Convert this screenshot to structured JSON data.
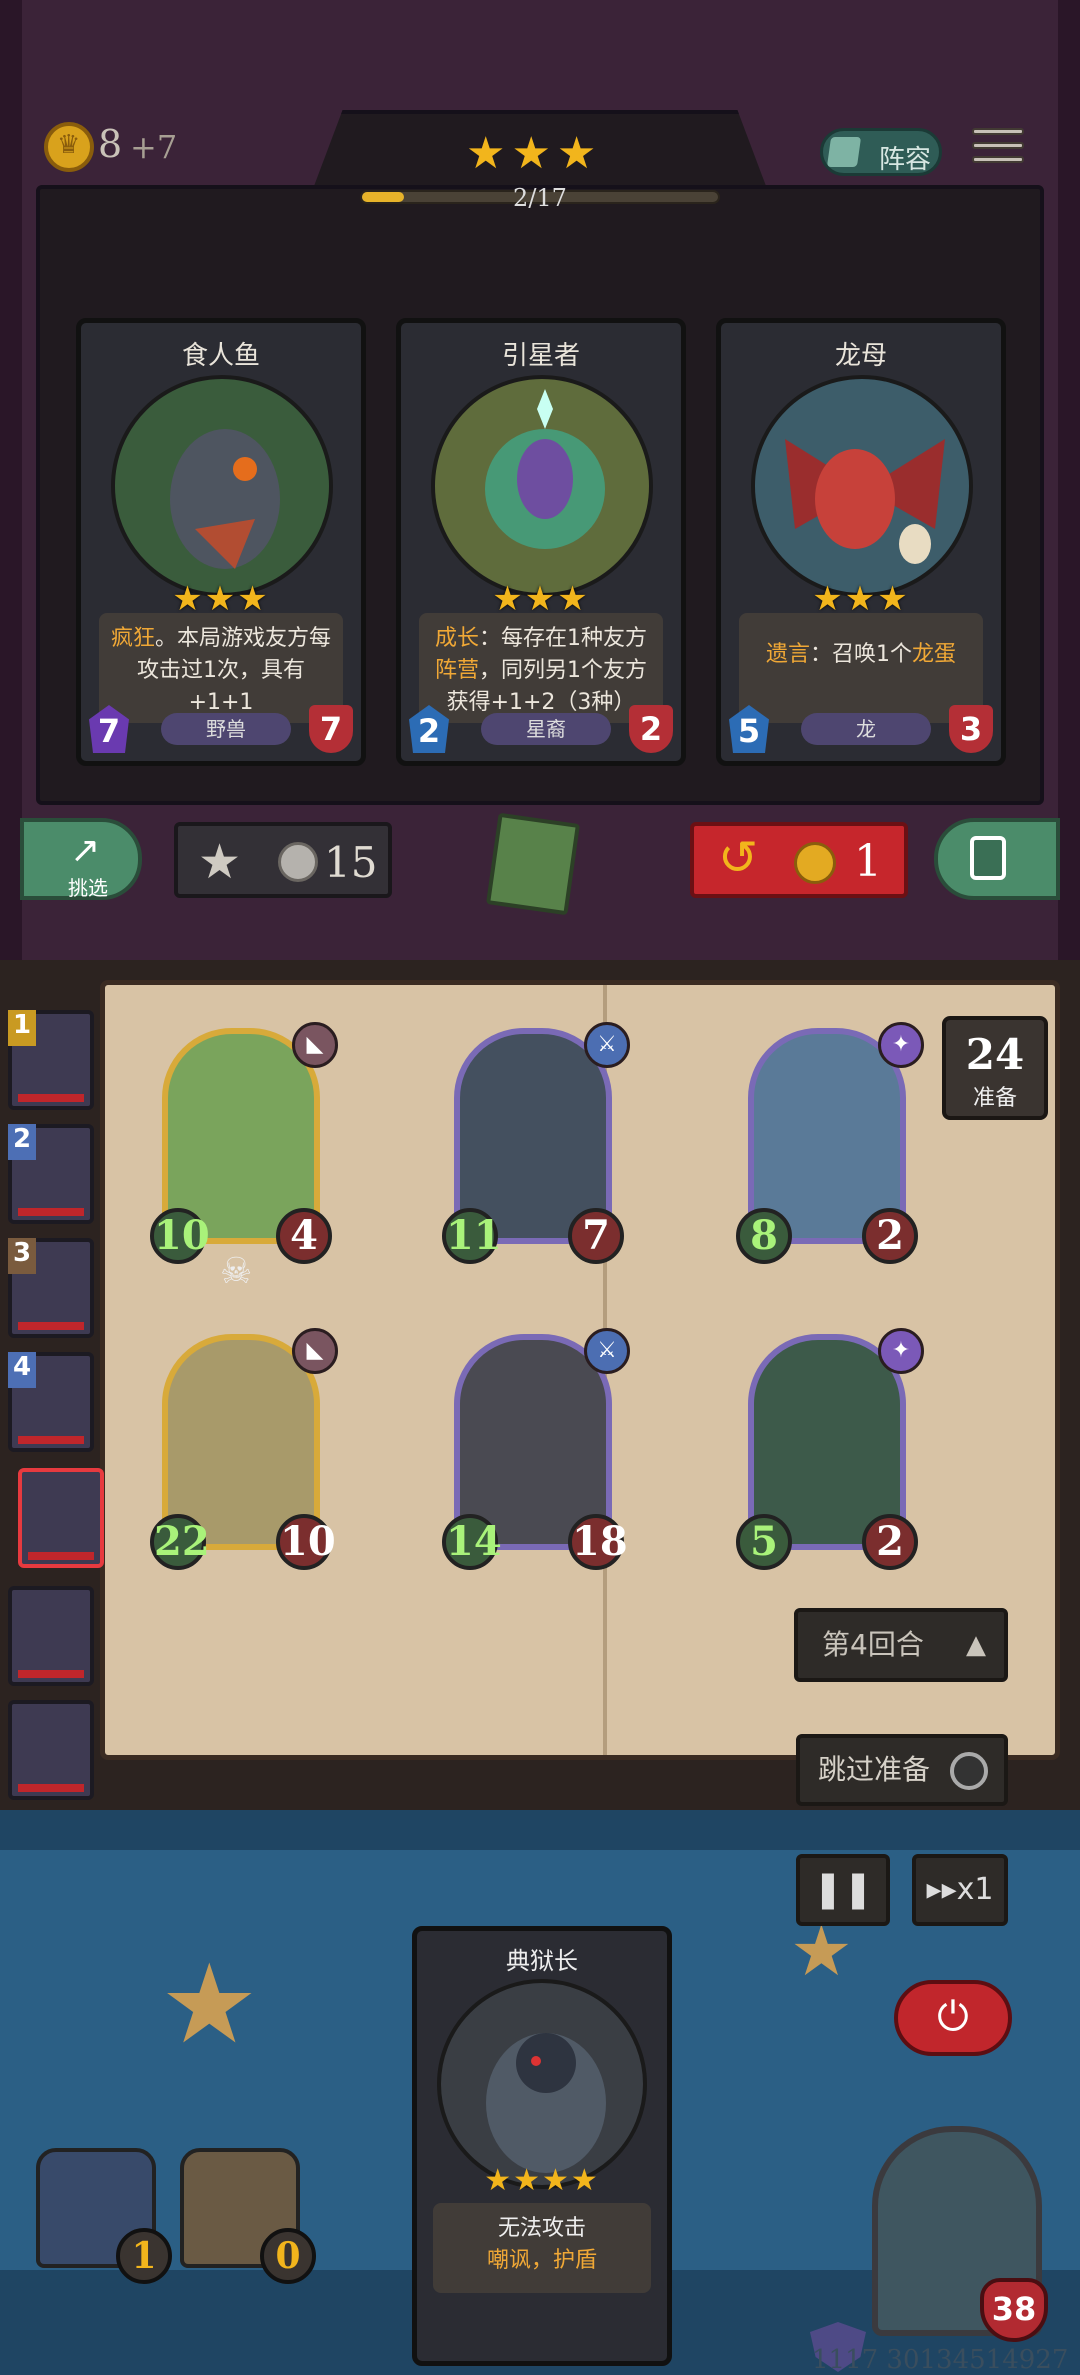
{
  "shop": {
    "gold": "8",
    "gold_income": "+7",
    "tavern_stars": "★★★",
    "level_progress_text": "2/17",
    "level_progress_fraction": 0.1176,
    "lineup_label": "阵容",
    "select_label": "挑选",
    "upgrade_cost": "15",
    "reroll_cost": "1",
    "cards": [
      {
        "name": "食人鱼",
        "stars": "★★★",
        "desc_kw": "疯狂",
        "desc_rest": "。本局游戏友方每攻击过1次，具有+1+1",
        "atk": "7",
        "hp": "7",
        "tribe": "野兽"
      },
      {
        "name": "引星者",
        "stars": "★★★",
        "desc_kw": "成长",
        "desc_mid": "：每存在1种友方",
        "desc_kw2": "阵营",
        "desc_rest": "，同列另1个友方获得+1+2（3种）",
        "atk": "2",
        "hp": "2",
        "tribe": "星裔"
      },
      {
        "name": "龙母",
        "stars": "★★★",
        "desc_kw": "遗言",
        "desc_mid": "：召唤1个",
        "desc_kw2": "龙蛋",
        "atk": "5",
        "hp": "3",
        "tribe": "龙"
      }
    ]
  },
  "board": {
    "ready_count": "24",
    "ready_label": "准备",
    "round_label": "第4回合",
    "units": [
      {
        "atk": "10",
        "hp": "4"
      },
      {
        "atk": "11",
        "hp": "7"
      },
      {
        "atk": "8",
        "hp": "2"
      },
      {
        "atk": "22",
        "hp": "10"
      },
      {
        "atk": "14",
        "hp": "18"
      },
      {
        "atk": "5",
        "hp": "2"
      }
    ],
    "roster_ranks": [
      "1",
      "2",
      "3",
      "4"
    ]
  },
  "controls": {
    "skip_label": "跳过准备",
    "speed_label": "x1"
  },
  "hero": {
    "card_name": "典狱长",
    "stars": "★★★★",
    "desc_line1": "无法攻击",
    "desc_line2": "嘲讽，护盾",
    "health": "38",
    "chest_left": "1",
    "chest_right": "0"
  },
  "watermark": "1117 30134514927",
  "colors": {
    "gold": "#f2b51c",
    "accent_red": "#c6262c",
    "accent_green": "#4b8c6a"
  }
}
